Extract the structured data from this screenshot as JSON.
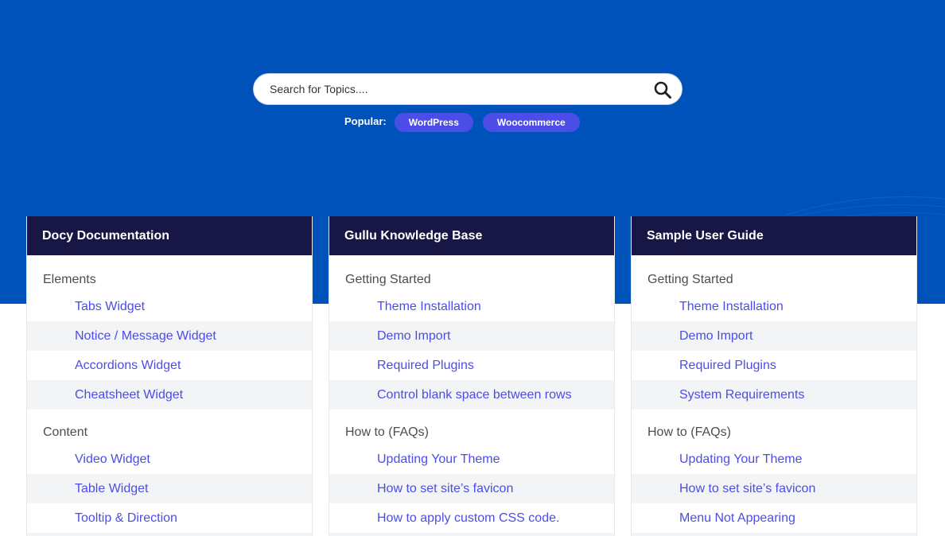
{
  "search": {
    "placeholder": "Search for Topics...."
  },
  "popular": {
    "label": "Popular:",
    "tags": [
      "WordPress",
      "Woocommerce"
    ]
  },
  "colors": {
    "hero_bg": "#0052bb",
    "card_header_bg": "#171644",
    "tag_bg": "#4c4de6",
    "link": "#4c4de6"
  },
  "cards": [
    {
      "title": "Docy Documentation",
      "sections": [
        {
          "title": "Elements",
          "items": [
            "Tabs Widget",
            "Notice / Message Widget",
            "Accordions Widget",
            "Cheatsheet Widget"
          ]
        },
        {
          "title": "Content",
          "items": [
            "Video Widget",
            "Table Widget",
            "Tooltip & Direction"
          ]
        }
      ]
    },
    {
      "title": "Gullu Knowledge Base",
      "sections": [
        {
          "title": "Getting Started",
          "items": [
            "Theme Installation",
            "Demo Import",
            "Required Plugins",
            "Control blank space between rows"
          ]
        },
        {
          "title": "How to (FAQs)",
          "items": [
            "Updating Your Theme",
            "How to set site’s favicon",
            "How to apply custom CSS code."
          ]
        }
      ]
    },
    {
      "title": "Sample User Guide",
      "sections": [
        {
          "title": "Getting Started",
          "items": [
            "Theme Installation",
            "Demo Import",
            "Required Plugins",
            "System Requirements"
          ]
        },
        {
          "title": "How to (FAQs)",
          "items": [
            "Updating Your Theme",
            "How to set site’s favicon",
            "Menu Not Appearing"
          ]
        }
      ]
    }
  ]
}
